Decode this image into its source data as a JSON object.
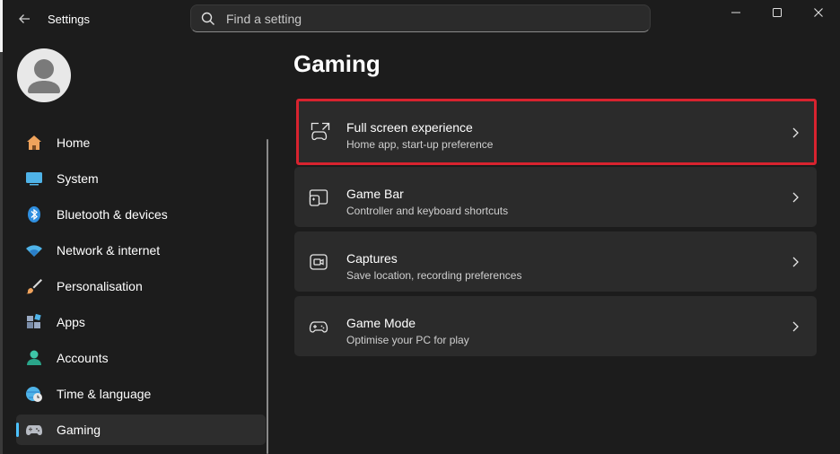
{
  "window": {
    "app_title": "Settings",
    "minimize_icon": "minimize-icon",
    "maximize_icon": "maximize-icon",
    "close_icon": "close-icon"
  },
  "search": {
    "placeholder": "Find a setting"
  },
  "sidebar": {
    "items": [
      {
        "label": "Home",
        "icon": "home-icon"
      },
      {
        "label": "System",
        "icon": "system-icon"
      },
      {
        "label": "Bluetooth & devices",
        "icon": "bluetooth-icon"
      },
      {
        "label": "Network & internet",
        "icon": "wifi-icon"
      },
      {
        "label": "Personalisation",
        "icon": "brush-icon"
      },
      {
        "label": "Apps",
        "icon": "apps-icon"
      },
      {
        "label": "Accounts",
        "icon": "accounts-icon"
      },
      {
        "label": "Time & language",
        "icon": "globe-clock-icon"
      },
      {
        "label": "Gaming",
        "icon": "controller-icon",
        "selected": true
      }
    ]
  },
  "main": {
    "title": "Gaming",
    "cards": [
      {
        "title": "Full screen experience",
        "subtitle": "Home app, start-up preference",
        "icon": "fullscreen-controller-icon",
        "highlighted": true
      },
      {
        "title": "Game Bar",
        "subtitle": "Controller and keyboard shortcuts",
        "icon": "game-bar-icon"
      },
      {
        "title": "Captures",
        "subtitle": "Save location, recording preferences",
        "icon": "capture-icon"
      },
      {
        "title": "Game Mode",
        "subtitle": "Optimise your PC for play",
        "icon": "game-mode-icon"
      }
    ]
  },
  "colors": {
    "background": "#1c1c1c",
    "card": "#2b2b2b",
    "accent": "#4cc2ff",
    "highlight_border": "#d8232f"
  }
}
